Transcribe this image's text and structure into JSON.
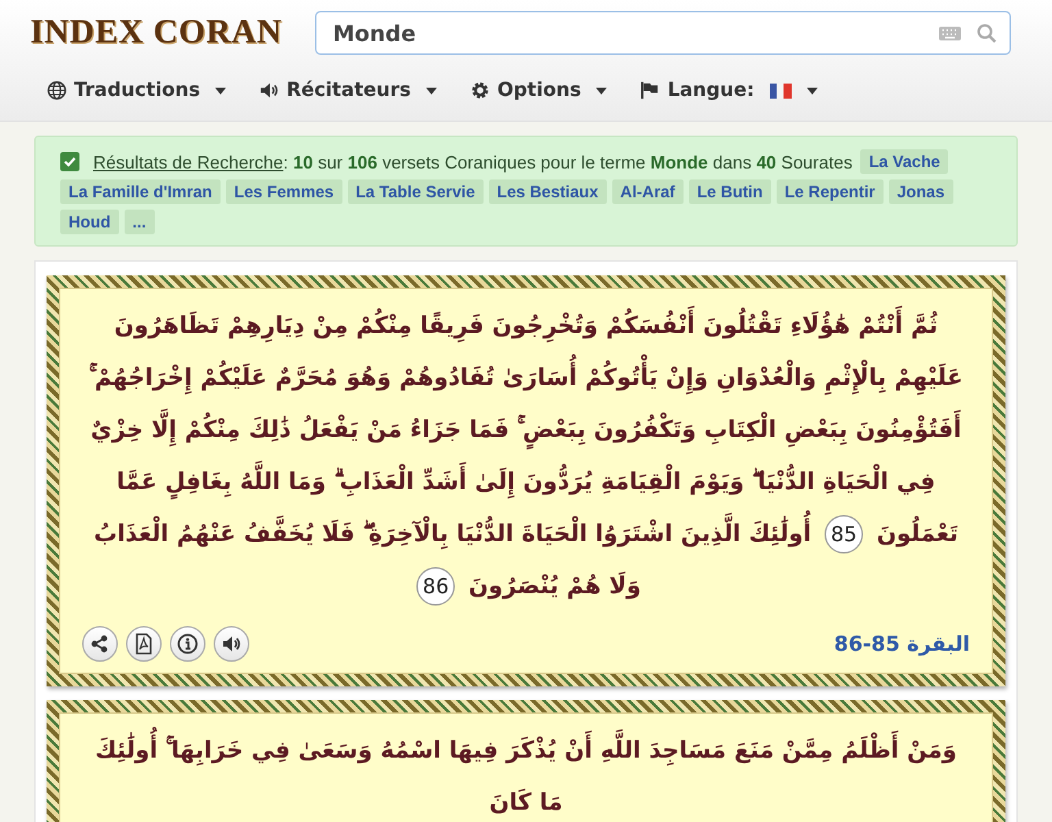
{
  "logo": {
    "text": "INDEX CORAN"
  },
  "search": {
    "value": "Monde"
  },
  "menu": [
    {
      "label": "Traductions",
      "flag": false
    },
    {
      "label": "Récitateurs",
      "flag": false
    },
    {
      "label": "Options",
      "flag": false
    },
    {
      "label": "Langue:",
      "flag": true
    }
  ],
  "results": {
    "checked": true,
    "link": "Résultats de Recherche",
    "summary": ": **10** sur **106** versets Coraniques pour le terme **Monde** dans **40** Sourates",
    "tags": [
      "La Vache",
      "La Famille d'Imran",
      "Les Femmes",
      "La Table Servie",
      "Les Bestiaux",
      "Al-Araf",
      "Le Butin",
      "Le Repentir",
      "Jonas",
      "Houd",
      "..."
    ]
  },
  "verses": [
    {
      "segments": [
        {
          "kind": "text",
          "text": "ثُمَّ أَنْتُمْ هَٰؤُلَاءِ تَقْتُلُونَ أَنْفُسَكُمْ وَتُخْرِجُونَ فَرِيقًا مِنْكُمْ مِنْ دِيَارِهِمْ تَظَاهَرُونَ عَلَيْهِمْ بِالْإِثْمِ وَالْعُدْوَانِ وَإِنْ يَأْتُوكُمْ أُسَارَىٰ تُفَادُوهُمْ وَهُوَ مُحَرَّمٌ عَلَيْكُمْ إِخْرَاجُهُمْ ۚ أَفَتُؤْمِنُونَ بِبَعْضِ الْكِتَابِ وَتَكْفُرُونَ بِبَعْضٍ ۚ فَمَا جَزَاءُ مَنْ يَفْعَلُ ذَٰلِكَ مِنْكُمْ إِلَّا خِزْيٌ فِي الْحَيَاةِ الدُّنْيَا ۖ وَيَوْمَ الْقِيَامَةِ يُرَدُّونَ إِلَىٰ أَشَدِّ الْعَذَابِ ۗ وَمَا اللَّهُ بِغَافِلٍ عَمَّا تَعْمَلُونَ"
        },
        {
          "kind": "number",
          "text": "85"
        },
        {
          "kind": "text",
          "text": "أُولَٰئِكَ الَّذِينَ اشْتَرَوُا الْحَيَاةَ الدُّنْيَا بِالْآخِرَةِ ۖ فَلَا يُخَفَّفُ عَنْهُمُ الْعَذَابُ وَلَا هُمْ يُنْصَرُونَ"
        },
        {
          "kind": "number",
          "text": "86"
        }
      ],
      "reference": "البقرة 85-86"
    },
    {
      "segments": [
        {
          "kind": "text",
          "text": "وَمَنْ أَظْلَمُ مِمَّنْ مَنَعَ مَسَاجِدَ اللَّهِ أَنْ يُذْكَرَ فِيهَا اسْمُهُ وَسَعَىٰ فِي خَرَابِهَا ۚ أُولَٰئِكَ مَا كَانَ"
        }
      ]
    }
  ]
}
